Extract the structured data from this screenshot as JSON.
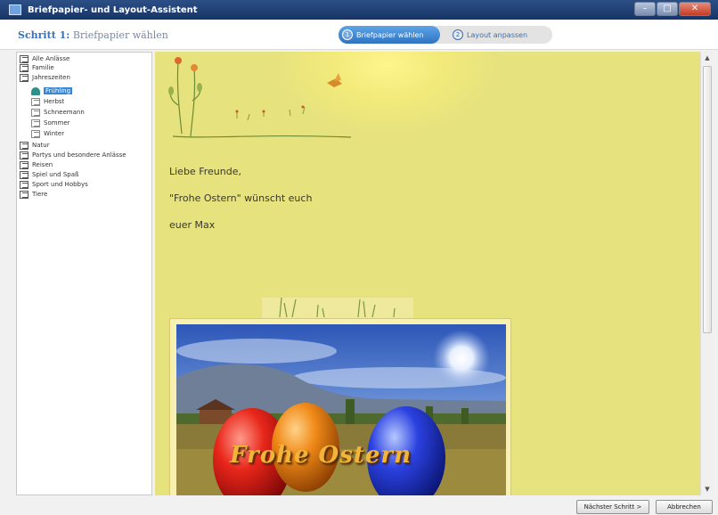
{
  "window": {
    "title": "Briefpapier- und Layout-Assistent"
  },
  "header": {
    "step_prefix": "Schritt 1:",
    "step_title": "Briefpapier wählen",
    "steps": [
      {
        "num": "1",
        "label": "Briefpapier wählen",
        "active": true
      },
      {
        "num": "2",
        "label": "Layout anpassen",
        "active": false
      }
    ]
  },
  "tree": {
    "items": [
      {
        "label": "Alle Anlässe",
        "level": 0
      },
      {
        "label": "Familie",
        "level": 0
      },
      {
        "label": "Jahreszeiten",
        "level": 0
      },
      {
        "label": "Frühling",
        "level": 1,
        "selected": true
      },
      {
        "label": "Herbst",
        "level": 1
      },
      {
        "label": "Schneemann",
        "level": 1
      },
      {
        "label": "Sommer",
        "level": 1
      },
      {
        "label": "Winter",
        "level": 1
      },
      {
        "label": "Natur",
        "level": 0
      },
      {
        "label": "Partys und besondere Anlässe",
        "level": 0
      },
      {
        "label": "Reisen",
        "level": 0
      },
      {
        "label": "Spiel und Spaß",
        "level": 0
      },
      {
        "label": "Sport und Hobbys",
        "level": 0
      },
      {
        "label": "Tiere",
        "level": 0
      }
    ]
  },
  "preview": {
    "background_color": "#e6e27e",
    "greeting": "Liebe Freunde,",
    "line2": "\"Frohe Ostern\" wünscht euch",
    "signature": "euer Max",
    "photo_caption": "Frohe Ostern"
  },
  "footer": {
    "next_button": "Nächster Schritt >",
    "cancel_button": "Abbrechen"
  },
  "icons": {
    "tree_folder": "stationery-folder-icon",
    "tree_selected": "spring-icon"
  }
}
